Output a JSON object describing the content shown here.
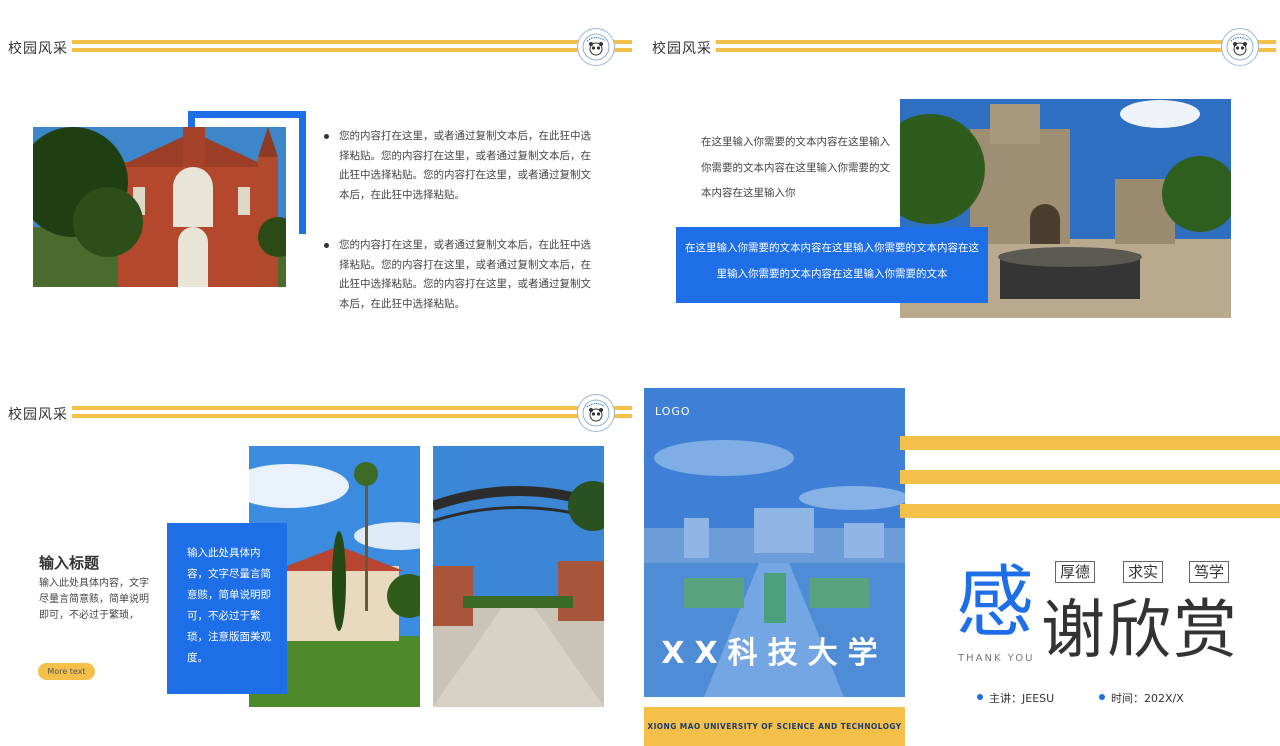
{
  "colors": {
    "accent_blue": "#1e6ee8",
    "accent_yellow": "#f5c04a"
  },
  "header": {
    "section_title": "校园风采",
    "badge_icon": "school-seal-icon"
  },
  "slide1": {
    "bullets": [
      "您的内容打在这里，或者通过复制文本后，在此狂中选择粘贴。您的内容打在这里，或者通过复制文本后，在此狂中选择粘贴。您的内容打在这里，或者通过复制文本后，在此狂中选择粘贴。",
      "您的内容打在这里，或者通过复制文本后，在此狂中选择粘贴。您的内容打在这里，或者通过复制文本后，在此狂中选择粘贴。您的内容打在这里，或者通过复制文本后，在此狂中选择粘贴。"
    ]
  },
  "slide2": {
    "text": "在这里输入你需要的文本内容在这里输入你需要的文本内容在这里输入你需要的文本内容在这里输入你",
    "box_text": "在这里输入你需要的文本内容在这里输入你需要的文本内容在这里输入你需要的文本内容在这里输入你需要的文本"
  },
  "slide3": {
    "title": "输入标题",
    "body": "输入此处具体内容，文字尽量言简意赅，简单说明即可，不必过于繁琐，",
    "more_label": "More text",
    "box_text": "输入此处具体内容，文字尽量言简意赅，简单说明即可，不必过于繁琐，注意版面美观度。"
  },
  "slide4": {
    "logo": "LOGO",
    "university": "XX科技大学",
    "university_en": "XIONG MAO UNIVERSITY OF SCIENCE AND TECHNOLOGY",
    "tags": [
      "厚德",
      "求实",
      "笃学"
    ],
    "thanks_first": "感",
    "thanks_rest": "谢欣赏",
    "thank_you_en": "THANK YOU",
    "presenter": "主讲：JEESU",
    "date": "时间：202X/X"
  }
}
